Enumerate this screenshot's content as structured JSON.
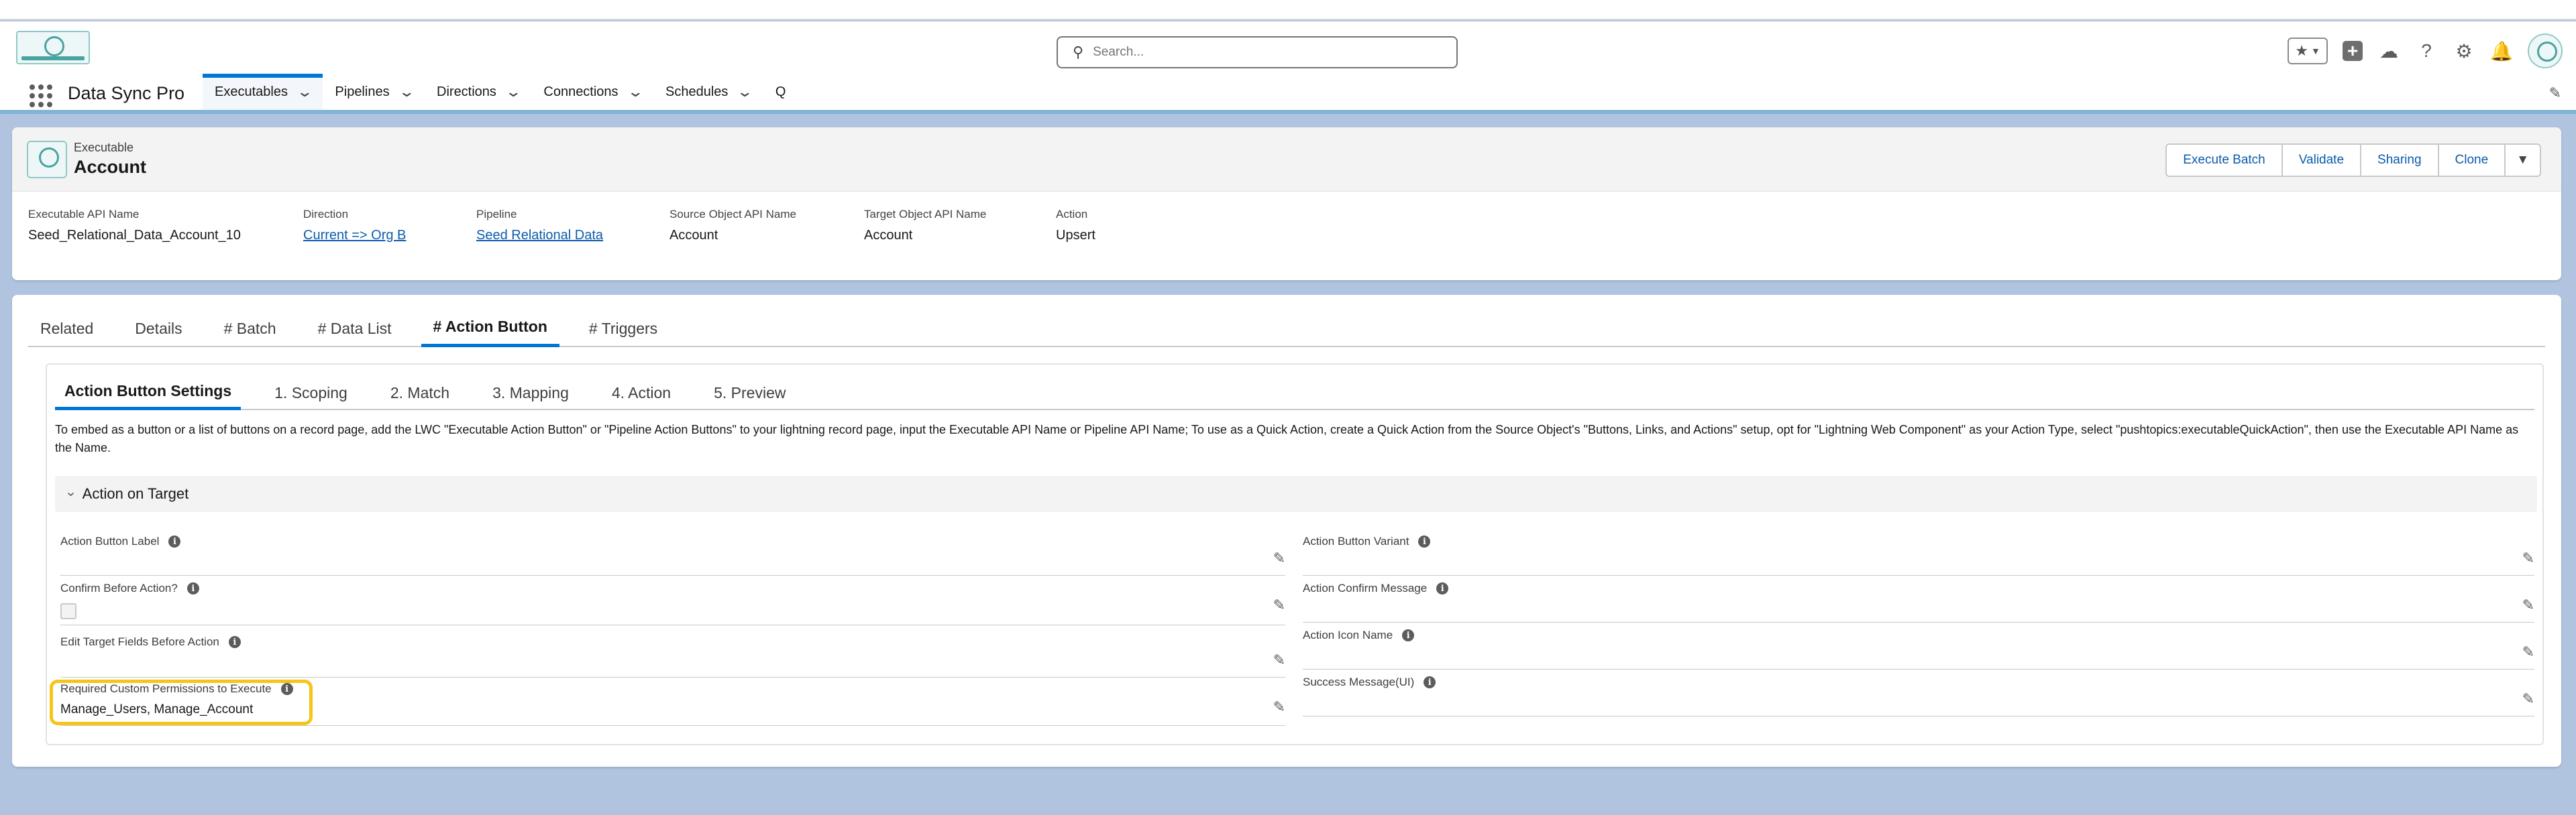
{
  "search": {
    "placeholder": "Search..."
  },
  "nav": {
    "app_name": "Data Sync Pro",
    "tabs": [
      {
        "label": "Executables",
        "has_menu": true,
        "active": true
      },
      {
        "label": "Pipelines",
        "has_menu": true
      },
      {
        "label": "Directions",
        "has_menu": true
      },
      {
        "label": "Connections",
        "has_menu": true
      },
      {
        "label": "Schedules",
        "has_menu": true
      },
      {
        "label": "Q",
        "has_menu": false
      }
    ]
  },
  "record": {
    "object_type": "Executable",
    "name": "Account",
    "actions": [
      "Execute Batch",
      "Validate",
      "Sharing",
      "Clone"
    ],
    "fields": [
      {
        "label": "Executable API Name",
        "value": "Seed_Relational_Data_Account_10",
        "link": false
      },
      {
        "label": "Direction",
        "value": "Current => Org B",
        "link": true
      },
      {
        "label": "Pipeline",
        "value": "Seed Relational Data",
        "link": true
      },
      {
        "label": "Source Object API Name",
        "value": "Account",
        "link": false
      },
      {
        "label": "Target Object API Name",
        "value": "Account",
        "link": false
      },
      {
        "label": "Action",
        "value": "Upsert",
        "link": false
      }
    ]
  },
  "record_tabs": [
    "Related",
    "Details",
    "# Batch",
    "# Data List",
    "# Action Button",
    "# Triggers"
  ],
  "record_tab_active": "# Action Button",
  "inner_tabs": [
    "Action Button Settings",
    "1. Scoping",
    "2. Match",
    "3. Mapping",
    "4. Action",
    "5. Preview"
  ],
  "inner_tab_active": "Action Button Settings",
  "description": "To embed as a button or a list of buttons on a record page, add the LWC \"Executable Action Button\" or \"Pipeline Action Buttons\" to your lightning record page, input the Executable API Name or Pipeline API Name; To use as a Quick Action, create a Quick Action from the Source Object's \"Buttons, Links, and Actions\" setup, opt for \"Lightning Web Component\" as your Action Type, select \"pushtopics:executableQuickAction\", then use the Executable API Name as the Name.",
  "section_title": "Action on Target",
  "form": {
    "left": [
      {
        "label": "Action Button Label",
        "value": ""
      },
      {
        "label": "Confirm Before Action?",
        "value": "",
        "checkbox": true,
        "checked": false
      },
      {
        "label": "Edit Target Fields Before Action",
        "value": ""
      },
      {
        "label": "Required Custom Permissions to Execute",
        "value": "Manage_Users, Manage_Account",
        "highlighted": true
      }
    ],
    "right": [
      {
        "label": "Action Button Variant",
        "value": ""
      },
      {
        "label": "Action Confirm Message",
        "value": ""
      },
      {
        "label": "Action Icon Name",
        "value": ""
      },
      {
        "label": "Success Message(UI)",
        "value": ""
      }
    ]
  },
  "colors": {
    "brand": "#0176d3",
    "link": "#0b5cab",
    "background": "#b0c4df",
    "highlight": "#f5c518"
  }
}
